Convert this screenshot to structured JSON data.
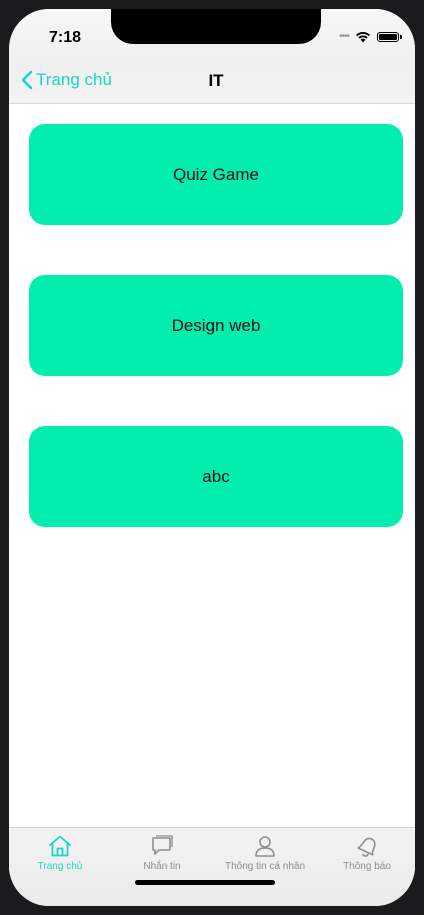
{
  "status_bar": {
    "time": "7:18",
    "icons": [
      "cellular-signal-icon",
      "wifi-icon",
      "battery-icon"
    ]
  },
  "nav_bar": {
    "back_label": "Trang chủ",
    "title": "IT",
    "accent_color": "#19d6c4"
  },
  "cards": [
    {
      "label": "Quiz Game"
    },
    {
      "label": "Design web"
    },
    {
      "label": "abc"
    }
  ],
  "card_color": "#02eeaf",
  "tab_bar": {
    "items": [
      {
        "label": "Trang chủ",
        "icon": "home-icon",
        "active": true
      },
      {
        "label": "Nhắn tin",
        "icon": "chat-icon",
        "active": false
      },
      {
        "label": "Thông tin cá nhân",
        "icon": "profile-icon",
        "active": false
      },
      {
        "label": "Thông báo",
        "icon": "bell-icon",
        "active": false
      }
    ]
  }
}
